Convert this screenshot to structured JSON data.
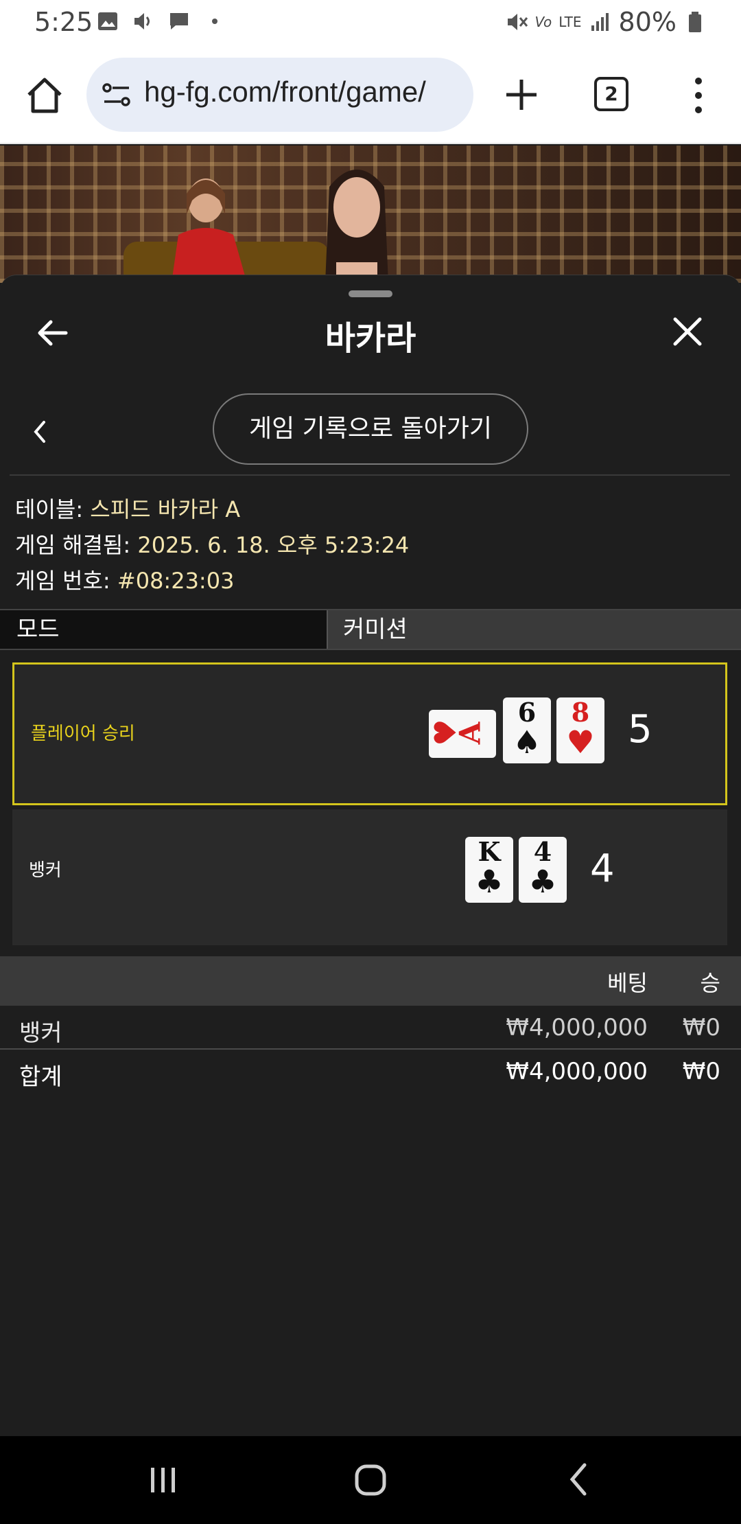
{
  "status_bar": {
    "time": "5:25",
    "battery": "80%",
    "network": "LTE"
  },
  "browser": {
    "url": "hg-fg.com/front/game/",
    "tab_count": "2"
  },
  "panel": {
    "title": "바카라",
    "history_button": "게임 기록으로 돌아가기",
    "info": {
      "table_label": "테이블:",
      "table_value": "스피드 바카라 A",
      "resolved_label": "게임 해결됨:",
      "resolved_value": "2025. 6. 18. 오후 5:23:24",
      "game_no_label": "게임 번호:",
      "game_no_value": "#08:23:03"
    },
    "tabs": {
      "mode": "모드",
      "commission": "커미션"
    },
    "results": {
      "player": {
        "label": "플레이어 승리",
        "score": "5",
        "cards": [
          {
            "rank": "A",
            "suit": "♥",
            "color": "red"
          },
          {
            "rank": "6",
            "suit": "♠",
            "color": "black"
          },
          {
            "rank": "8",
            "suit": "♥",
            "color": "red"
          }
        ]
      },
      "banker": {
        "label": "뱅커",
        "score": "4",
        "cards": [
          {
            "rank": "K",
            "suit": "♣",
            "color": "black"
          },
          {
            "rank": "4",
            "suit": "♣",
            "color": "black"
          }
        ]
      }
    },
    "bets": {
      "header_bet": "베팅",
      "header_win": "승",
      "rows": [
        {
          "label": "뱅커",
          "amount": "₩4,000,000",
          "win": "₩0"
        }
      ],
      "total": {
        "label": "합계",
        "amount": "₩4,000,000",
        "win": "₩0"
      }
    }
  },
  "colors": {
    "highlight": "#d4c51c",
    "player_label": "#e8d21c",
    "info_value": "#f5e6b0",
    "card_red": "#d62020"
  }
}
